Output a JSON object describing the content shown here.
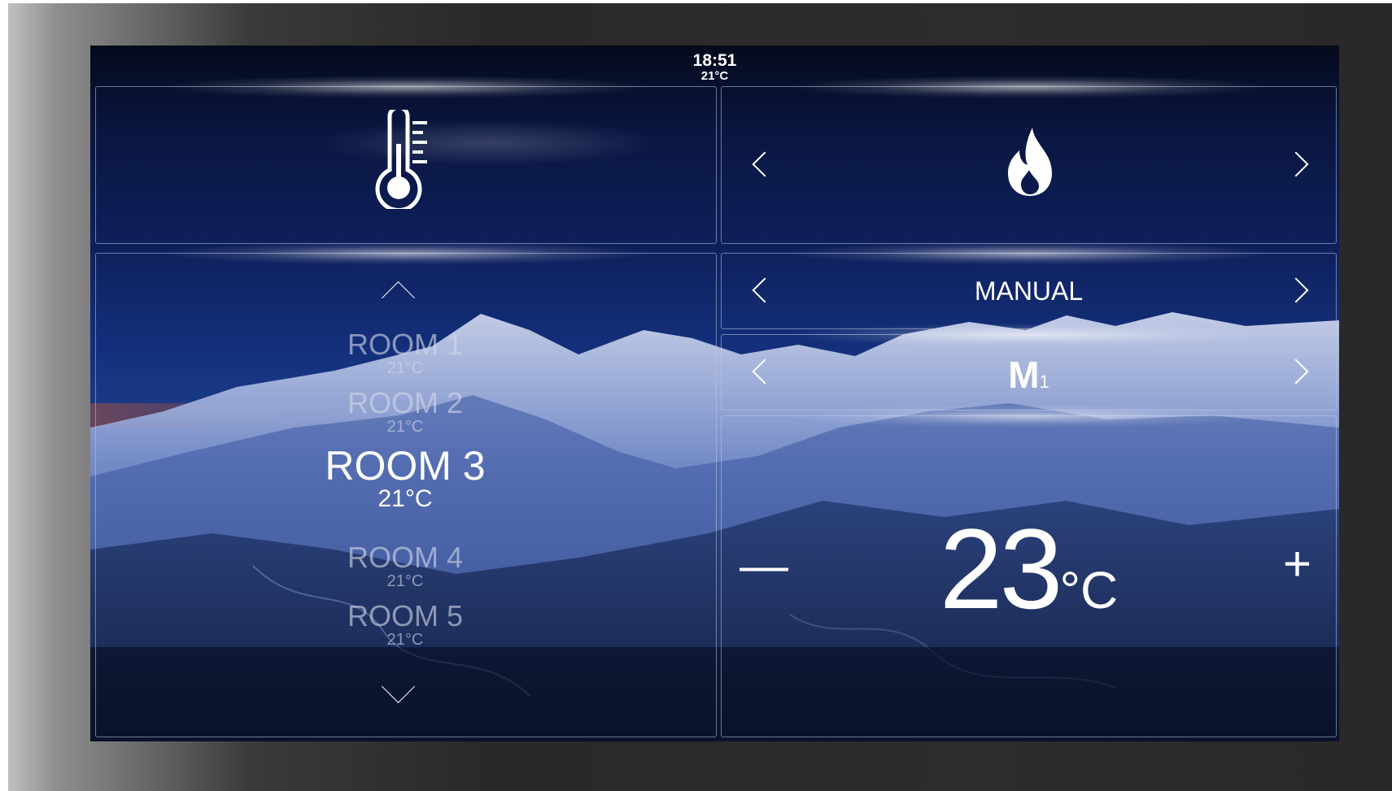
{
  "header": {
    "time": "18:51",
    "outdoor_temp": "21°C"
  },
  "sensor_icon": "thermometer-icon",
  "heating_icon": "flame-icon",
  "mode": {
    "label": "MANUAL"
  },
  "program": {
    "letter": "M",
    "subscript": "1"
  },
  "rooms": [
    {
      "name": "ROOM 1",
      "temp": "21°C"
    },
    {
      "name": "ROOM 2",
      "temp": "21°C"
    },
    {
      "name": "ROOM 3",
      "temp": "21°C"
    },
    {
      "name": "ROOM 4",
      "temp": "21°C"
    },
    {
      "name": "ROOM 5",
      "temp": "21°C"
    }
  ],
  "selected_room": "ROOM 3",
  "setpoint": {
    "value": "23",
    "unit": "°C",
    "minus": "—",
    "plus": "+"
  }
}
